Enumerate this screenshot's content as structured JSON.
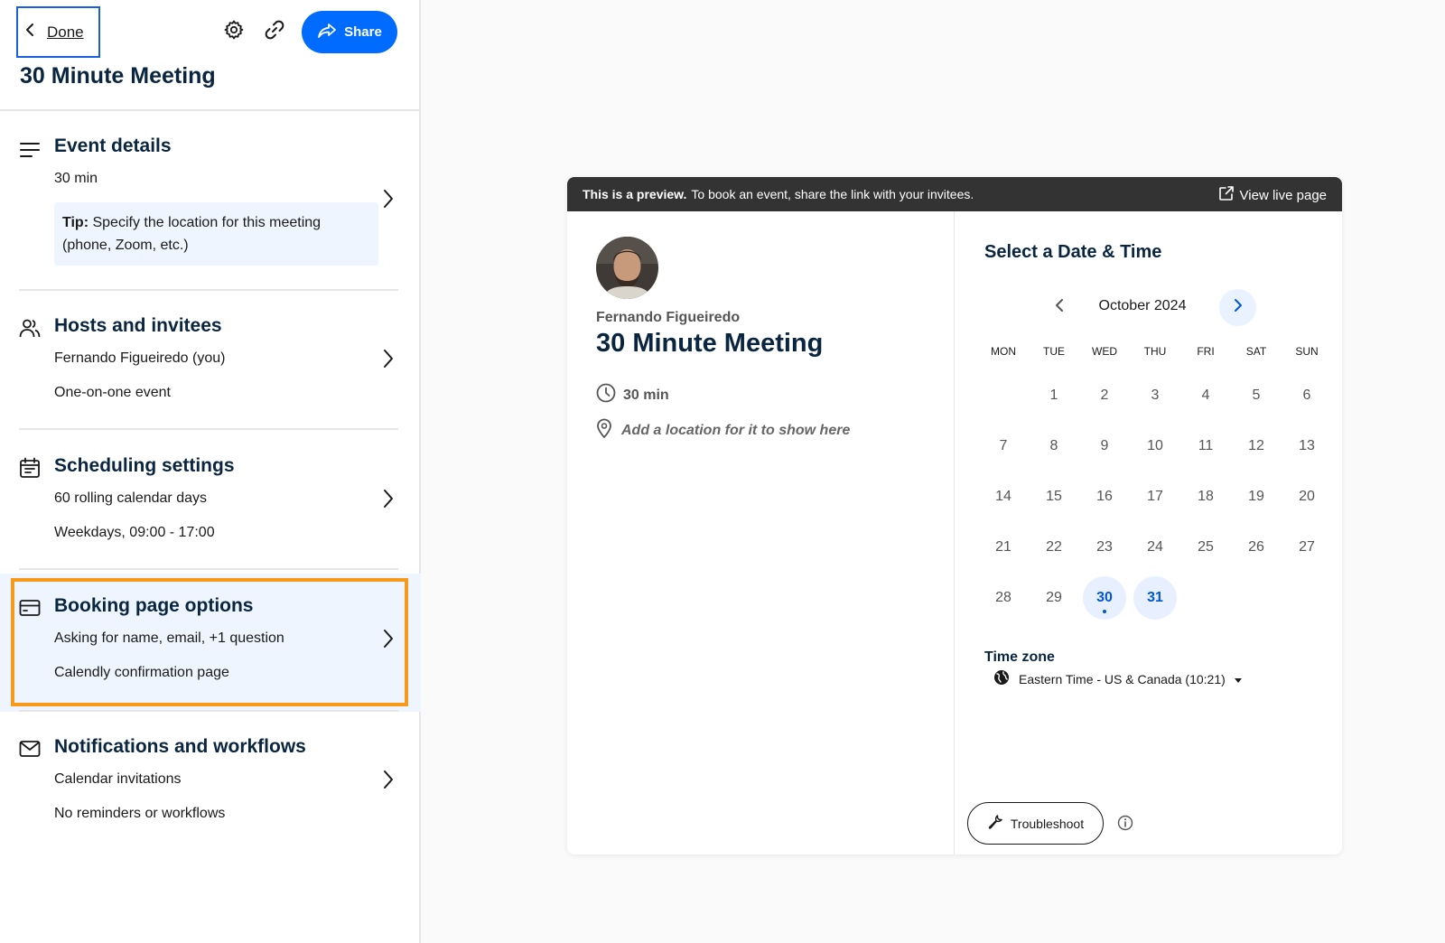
{
  "header": {
    "done_label": "Done",
    "share_label": "Share",
    "title": "30 Minute Meeting"
  },
  "sections": {
    "event_details": {
      "title": "Event details",
      "line1": "30 min",
      "tip_label": "Tip:",
      "tip_text": " Specify the location for this meeting (phone, Zoom, etc.)"
    },
    "hosts": {
      "title": "Hosts and invitees",
      "line1": "Fernando Figueiredo (you)",
      "line2": "One-on-one event"
    },
    "scheduling": {
      "title": "Scheduling settings",
      "line1": "60 rolling calendar days",
      "line2": "Weekdays, 09:00 - 17:00"
    },
    "booking": {
      "title": "Booking page options",
      "line1": "Asking for name, email, +1 question",
      "line2": "Calendly confirmation page"
    },
    "notifications": {
      "title": "Notifications and workflows",
      "line1": "Calendar invitations",
      "line2": "No reminders or workflows"
    }
  },
  "preview": {
    "banner_bold": "This is a preview.",
    "banner_text": "To book an event, share the link with your invitees.",
    "view_live": "View live page",
    "host_name": "Fernando Figueiredo",
    "event_name": "30 Minute Meeting",
    "duration": "30 min",
    "location_placeholder": "Add a location for it to show here",
    "select_title": "Select a Date & Time",
    "month": "October 2024",
    "weekdays": [
      "MON",
      "TUE",
      "WED",
      "THU",
      "FRI",
      "SAT",
      "SUN"
    ],
    "days": [
      "1",
      "2",
      "3",
      "4",
      "5",
      "6",
      "7",
      "8",
      "9",
      "10",
      "11",
      "12",
      "13",
      "14",
      "15",
      "16",
      "17",
      "18",
      "19",
      "20",
      "21",
      "22",
      "23",
      "24",
      "25",
      "26",
      "27",
      "28",
      "29",
      "30",
      "31"
    ],
    "first_weekday_offset": 1,
    "available_days": [
      "30",
      "31"
    ],
    "today": "30",
    "timezone_label": "Time zone",
    "timezone_value": "Eastern Time - US & Canada (10:21)",
    "troubleshoot_label": "Troubleshoot"
  },
  "colors": {
    "accent": "#006bff",
    "highlight_border": "#f79a1c",
    "highlight_bg": "#eef5ff",
    "title_text": "#0a2540"
  },
  "icons": {
    "back": "chevron-left-icon",
    "settings": "gear-icon",
    "link": "link-icon",
    "share": "share-arrow-icon",
    "event_details": "lines-icon",
    "hosts": "users-icon",
    "scheduling": "calendar-icon",
    "booking": "credit-card-icon",
    "notifications": "envelope-icon"
  }
}
